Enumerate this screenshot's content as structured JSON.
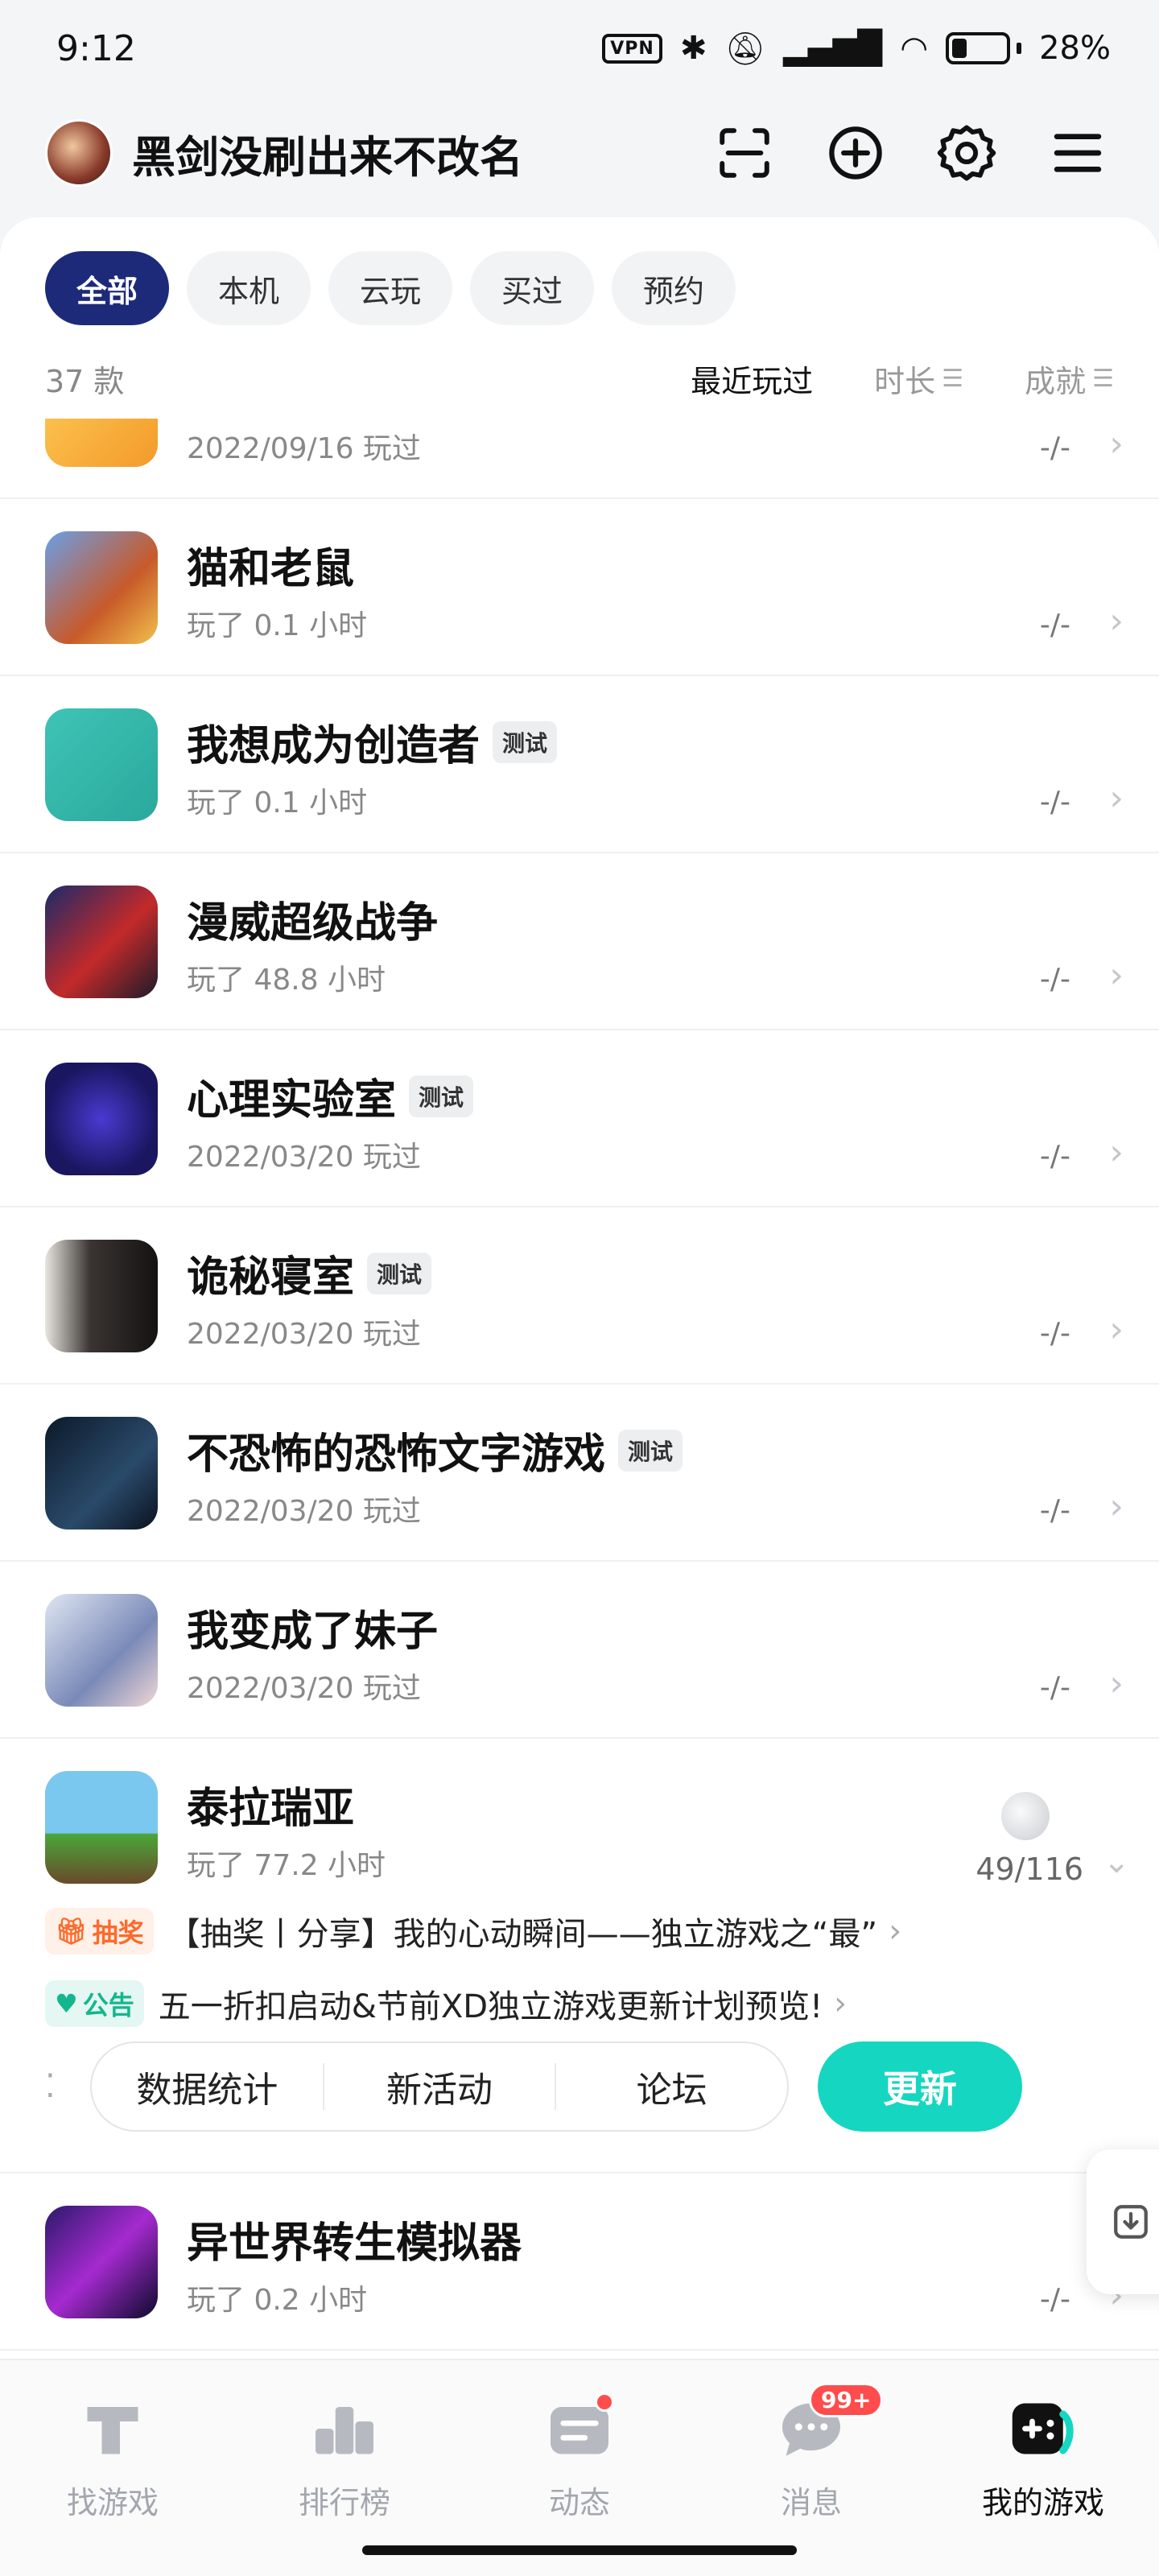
{
  "status": {
    "time": "9:12",
    "vpn": "VPN",
    "battery_text": "28%",
    "battery_level": 0.28
  },
  "header": {
    "username": "黑剑没刷出来不改名"
  },
  "filters": {
    "tabs": [
      "全部",
      "本机",
      "云玩",
      "买过",
      "预约"
    ],
    "active_index": 0
  },
  "list_meta": {
    "count": "37 款",
    "sort_recent": "最近玩过",
    "sort_duration": "时长",
    "sort_achievement": "成就"
  },
  "games": [
    {
      "name": "…",
      "sub": "2022/09/16 玩过",
      "ach": "-/-",
      "badge": ""
    },
    {
      "name": "猫和老鼠",
      "sub": "玩了 0.1 小时",
      "ach": "-/-",
      "badge": ""
    },
    {
      "name": "我想成为创造者",
      "sub": "玩了 0.1 小时",
      "ach": "-/-",
      "badge": "测试"
    },
    {
      "name": "漫威超级战争",
      "sub": "玩了 48.8 小时",
      "ach": "-/-",
      "badge": ""
    },
    {
      "name": "心理实验室",
      "sub": "2022/03/20 玩过",
      "ach": "-/-",
      "badge": "测试"
    },
    {
      "name": "诡秘寝室",
      "sub": "2022/03/20 玩过",
      "ach": "-/-",
      "badge": "测试"
    },
    {
      "name": "不恐怖的恐怖文字游戏",
      "sub": "2022/03/20 玩过",
      "ach": "-/-",
      "badge": "测试"
    },
    {
      "name": "我变成了妹子",
      "sub": "2022/03/20 玩过",
      "ach": "-/-",
      "badge": ""
    }
  ],
  "featured": {
    "name": "泰拉瑞亚",
    "sub": "玩了 77.2 小时",
    "ach": "49/116",
    "news": [
      {
        "tag": "抽奖",
        "text": "【抽奖丨分享】我的心动瞬间——独立游戏之“最”"
      },
      {
        "tag": "公告",
        "text": "五一折扣启动&节前XD独立游戏更新计划预览!"
      }
    ],
    "actions": [
      "数据统计",
      "新活动",
      "论坛"
    ],
    "update": "更新"
  },
  "last_game": {
    "name": "异世界转生模拟器",
    "sub": "玩了 0.2 小时",
    "ach": "-/-"
  },
  "nav": {
    "items": [
      "找游戏",
      "排行榜",
      "动态",
      "消息",
      "我的游戏"
    ],
    "active_index": 4,
    "message_badge": "99+"
  }
}
